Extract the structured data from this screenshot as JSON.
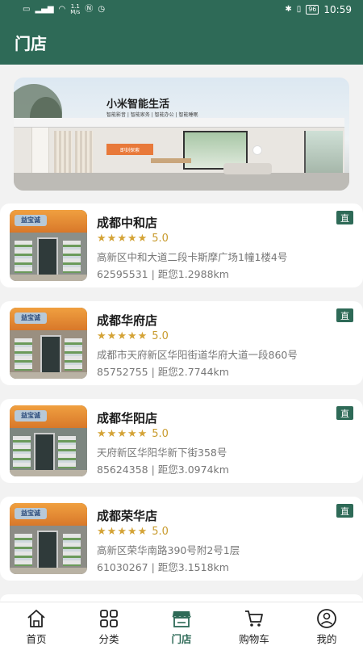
{
  "status_bar": {
    "left_icons": [
      "sim-icon",
      "signal-icon",
      "wifi-icon",
      "nfc-icon",
      "alarm-icon"
    ],
    "speed_value": "1.1",
    "speed_unit": "M/s",
    "battery": "96",
    "time": "10:59"
  },
  "header": {
    "title": "门店"
  },
  "banner": {
    "title": "小米智能生活",
    "subtitle": "智能影音 | 智能家务 | 智能办公 | 智能睡眠",
    "cta": "即刻探索"
  },
  "stores": [
    {
      "name": "成都中和店",
      "rating": "5.0",
      "stars": 5,
      "address": "高新区中和大道二段卡斯摩广场1幢1楼4号",
      "phone_distance": "62595531 | 距您1.2988km",
      "badge": "直",
      "photo_logo": "益宝诚"
    },
    {
      "name": "成都华府店",
      "rating": "5.0",
      "stars": 5,
      "address": "成都市天府新区华阳街道华府大道一段860号",
      "phone_distance": "85752755 | 距您2.7744km",
      "badge": "直",
      "photo_logo": "益宝诚"
    },
    {
      "name": "成都华阳店",
      "rating": "5.0",
      "stars": 5,
      "address": "天府新区华阳华新下街358号",
      "phone_distance": "85624358 | 距您3.0974km",
      "badge": "直",
      "photo_logo": "益宝诚"
    },
    {
      "name": "成都荣华店",
      "rating": "5.0",
      "stars": 5,
      "address": "高新区荣华南路390号附2号1层",
      "phone_distance": "61030267 | 距您3.1518km",
      "badge": "直",
      "photo_logo": "益宝诚"
    }
  ],
  "nav": {
    "items": [
      {
        "label": "首页",
        "icon": "home-icon"
      },
      {
        "label": "分类",
        "icon": "category-icon"
      },
      {
        "label": "门店",
        "icon": "store-icon",
        "active": true
      },
      {
        "label": "购物车",
        "icon": "cart-icon"
      },
      {
        "label": "我的",
        "icon": "profile-icon"
      }
    ]
  },
  "colors": {
    "primary": "#2e6a57",
    "star": "#d4a336",
    "cta": "#e8793a"
  }
}
